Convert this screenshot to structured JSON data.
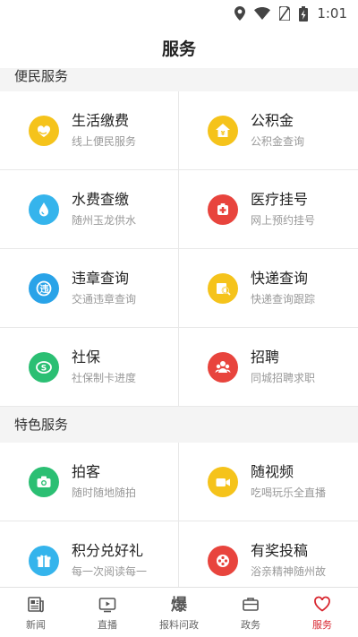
{
  "status": {
    "time": "1:01"
  },
  "header": {
    "title": "服务"
  },
  "sections": {
    "convenience": {
      "title": "便民服务",
      "items": [
        {
          "title": "生活缴费",
          "subtitle": "线上便民服务"
        },
        {
          "title": "公积金",
          "subtitle": "公积金查询"
        },
        {
          "title": "水费查缴",
          "subtitle": "随州玉龙供水"
        },
        {
          "title": "医疗挂号",
          "subtitle": "网上预约挂号"
        },
        {
          "title": "违章查询",
          "subtitle": "交通违章查询"
        },
        {
          "title": "快递查询",
          "subtitle": "快递查询跟踪"
        },
        {
          "title": "社保",
          "subtitle": "社保制卡进度"
        },
        {
          "title": "招聘",
          "subtitle": "同城招聘求职"
        }
      ]
    },
    "featured": {
      "title": "特色服务",
      "items": [
        {
          "title": "拍客",
          "subtitle": "随时随地随拍"
        },
        {
          "title": "随视频",
          "subtitle": "吃喝玩乐全直播"
        },
        {
          "title": "积分兑好礼",
          "subtitle": "每一次阅读每一"
        },
        {
          "title": "有奖投稿",
          "subtitle": "浴亲精神随州故"
        }
      ]
    }
  },
  "tabs": [
    {
      "label": "新闻"
    },
    {
      "label": "直播"
    },
    {
      "label": "报料问政"
    },
    {
      "label": "政务"
    },
    {
      "label": "服务"
    }
  ],
  "colors": {
    "yellow": "#f5c31b",
    "blue": "#29a3e8",
    "red": "#e8443d",
    "green": "#2bbf73",
    "lightblue": "#35b4ec",
    "active": "#d8262f"
  }
}
